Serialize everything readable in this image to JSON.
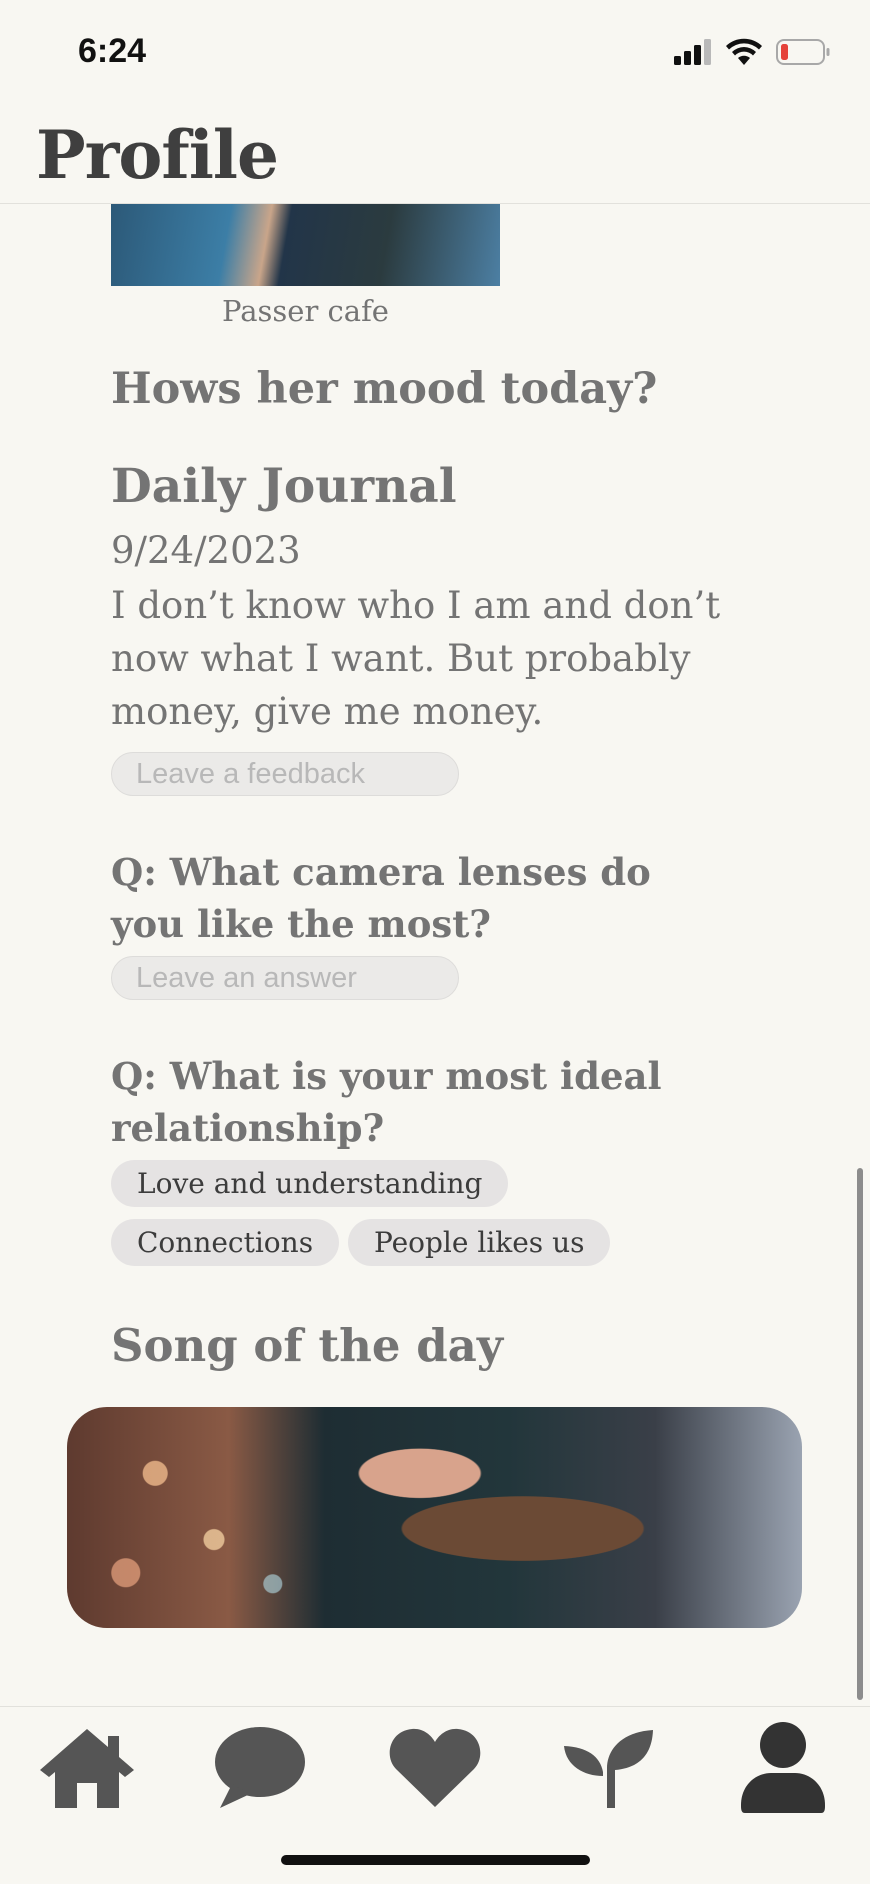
{
  "status_bar": {
    "time": "6:24"
  },
  "header": {
    "title": "Profile"
  },
  "photo": {
    "caption": "Passer cafe"
  },
  "mood": {
    "heading": "Hows her mood today?"
  },
  "journal": {
    "heading": "Daily Journal",
    "date": "9/24/2023",
    "text": "I don’t know who I am and don’t now what I want. But probably money, give me money.",
    "feedback_placeholder": "Leave a feedback"
  },
  "questions": [
    {
      "question": "Q: What camera lenses do you like the most?",
      "answer_placeholder": "Leave an answer"
    },
    {
      "question": "Q: What is your most ideal relationship?",
      "answers": [
        "Love and understanding",
        "Connections",
        "People likes us"
      ]
    }
  ],
  "song": {
    "heading": "Song of the day"
  },
  "tab_bar": {
    "items": [
      "home-icon",
      "chat-icon",
      "heart-icon",
      "sprout-icon",
      "profile-icon"
    ],
    "active": "profile-icon"
  },
  "colors": {
    "background": "#f8f7f2",
    "text": "#747474",
    "title": "#3f3f3f",
    "icon": "#555555",
    "tag_bg": "#e5e3e3"
  }
}
